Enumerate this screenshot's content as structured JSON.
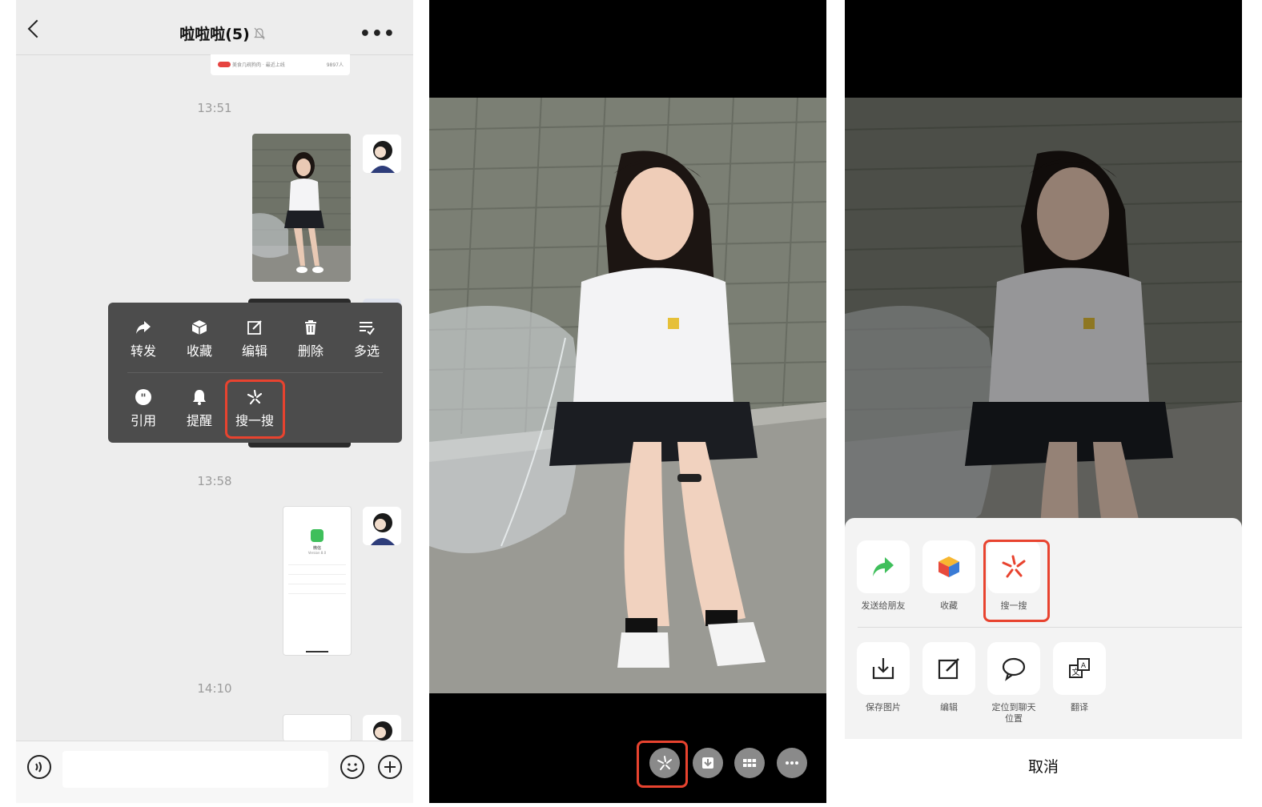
{
  "chat": {
    "title": "啦啦啦(5)",
    "more_label": "•••",
    "card_preview": {
      "source": "美食几碗狗肉 · 最近上线",
      "count": "9897人"
    },
    "timestamps": [
      "13:51",
      "13:58",
      "14:10"
    ],
    "context_menu": {
      "row1": [
        {
          "icon": "forward-icon",
          "label": "转发"
        },
        {
          "icon": "favorite-cube-icon",
          "label": "收藏"
        },
        {
          "icon": "edit-icon",
          "label": "编辑"
        },
        {
          "icon": "trash-icon",
          "label": "删除"
        },
        {
          "icon": "multi-select-icon",
          "label": "多选"
        }
      ],
      "row2": [
        {
          "icon": "quote-icon",
          "label": "引用"
        },
        {
          "icon": "bell-icon",
          "label": "提醒"
        },
        {
          "icon": "search-star-icon",
          "label": "搜一搜"
        }
      ]
    },
    "screenshot_msg": {
      "app_name": "微信",
      "version": "Version 8.0"
    }
  },
  "viewer": {
    "toolbar": [
      "search-star-icon",
      "download-icon",
      "grid-icon",
      "more-icon"
    ]
  },
  "share_sheet": {
    "row1": [
      {
        "icon": "share-arrow-icon",
        "label": "发送给朋友"
      },
      {
        "icon": "favorite-cube-icon",
        "label": "收藏"
      },
      {
        "icon": "search-star-icon",
        "label": "搜一搜"
      }
    ],
    "row2": [
      {
        "icon": "save-image-icon",
        "label": "保存图片"
      },
      {
        "icon": "edit-icon",
        "label": "编辑"
      },
      {
        "icon": "locate-chat-icon",
        "label": "定位到聊天位置"
      },
      {
        "icon": "translate-icon",
        "label": "翻译"
      }
    ],
    "cancel_label": "取消"
  },
  "colors": {
    "highlight": "#e8432f",
    "chat_bg": "#ededed",
    "menu_bg": "#4c4c4c",
    "share_green": "#3fbf5b",
    "search_red": "#e8432f"
  }
}
